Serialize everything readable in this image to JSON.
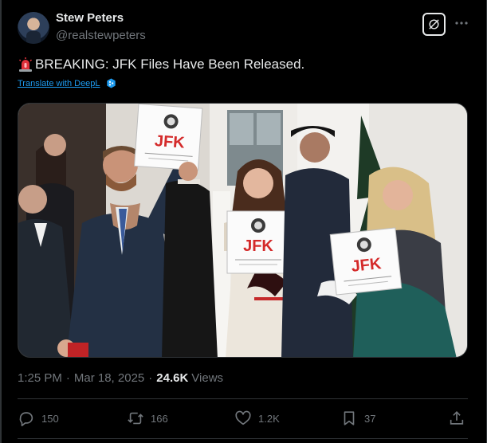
{
  "author": {
    "name": "Stew Peters",
    "handle": "@realstewpeters"
  },
  "tweet": {
    "text": "BREAKING: JFK Files Have Been Released.",
    "translate_label": "Translate with DeepL"
  },
  "media": {
    "sign_text": "JFK"
  },
  "meta": {
    "time": "1:25 PM",
    "date": "Mar 18, 2025",
    "separator": "·",
    "views_count": "24.6K",
    "views_label": "Views"
  },
  "actions": {
    "replies": "150",
    "reposts": "166",
    "likes": "1.2K",
    "bookmarks": "37"
  },
  "icons": [
    "siren-emoji-icon",
    "deepl-icon",
    "grok-icon",
    "more-icon",
    "reply-icon",
    "repost-icon",
    "like-icon",
    "bookmark-icon",
    "share-icon"
  ],
  "colors": {
    "background": "#000000",
    "text": "#e7e9ea",
    "secondary": "#71767b",
    "link": "#1d9bf0",
    "border": "#2f3336"
  }
}
